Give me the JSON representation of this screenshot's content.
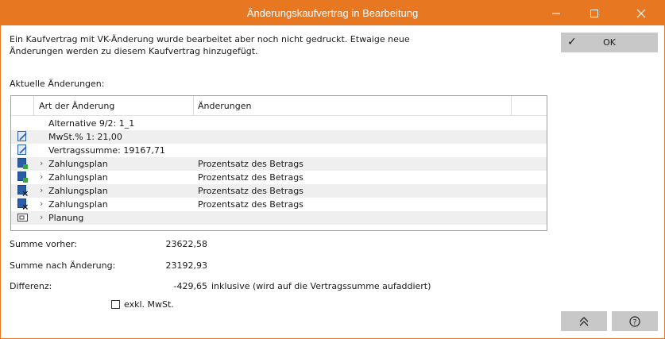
{
  "window": {
    "title": "Änderungskaufvertrag in Bearbeitung"
  },
  "message": {
    "line1": "Ein Kaufvertrag mit VK-Änderung wurde bearbeitet aber noch nicht gedruckt. Etwaige neue",
    "line2": "Änderungen werden zu diesem Kaufvertrag hinzugefügt."
  },
  "buttons": {
    "ok_label": "OK",
    "ok_icon": "checkmark-icon",
    "up_icon": "double-chevron-up-icon",
    "help_icon": "question-circle-icon"
  },
  "changes": {
    "section_label": "Aktuelle Änderungen:",
    "columns": [
      "Art der Änderung",
      "Änderungen"
    ],
    "rows": [
      {
        "icon": "none",
        "expandable": false,
        "name": "Alternative 9/2: 1_1",
        "change": ""
      },
      {
        "icon": "edit-icon",
        "expandable": false,
        "name": "MwSt.% 1: 21,00",
        "change": ""
      },
      {
        "icon": "edit-icon",
        "expandable": false,
        "name": "Vertragssumme: 19167,71",
        "change": ""
      },
      {
        "icon": "add-icon",
        "expandable": true,
        "name": "Zahlungsplan",
        "change": "Prozentsatz des Betrags"
      },
      {
        "icon": "add-icon",
        "expandable": true,
        "name": "Zahlungsplan",
        "change": "Prozentsatz des Betrags"
      },
      {
        "icon": "remove-icon",
        "expandable": true,
        "name": "Zahlungsplan",
        "change": "Prozentsatz des Betrags"
      },
      {
        "icon": "remove-icon",
        "expandable": true,
        "name": "Zahlungsplan",
        "change": "Prozentsatz des Betrags"
      },
      {
        "icon": "folder-icon",
        "expandable": true,
        "name": "Planung",
        "change": ""
      }
    ]
  },
  "summary": {
    "before_label": "Summe vorher:",
    "before_value": "23622,58",
    "after_label": "Summe nach Änderung:",
    "after_value": "23192,93",
    "diff_label": "Differenz:",
    "diff_value": "-429,65",
    "diff_note": "inklusive (wird auf die Vertragssumme aufaddiert)"
  },
  "options": {
    "excl_vat_label": "exkl. MwSt.",
    "excl_vat_checked": false
  },
  "colors": {
    "accent": "#e87722",
    "button_bg": "#c8c8c8",
    "row_alt": "#efefef"
  }
}
